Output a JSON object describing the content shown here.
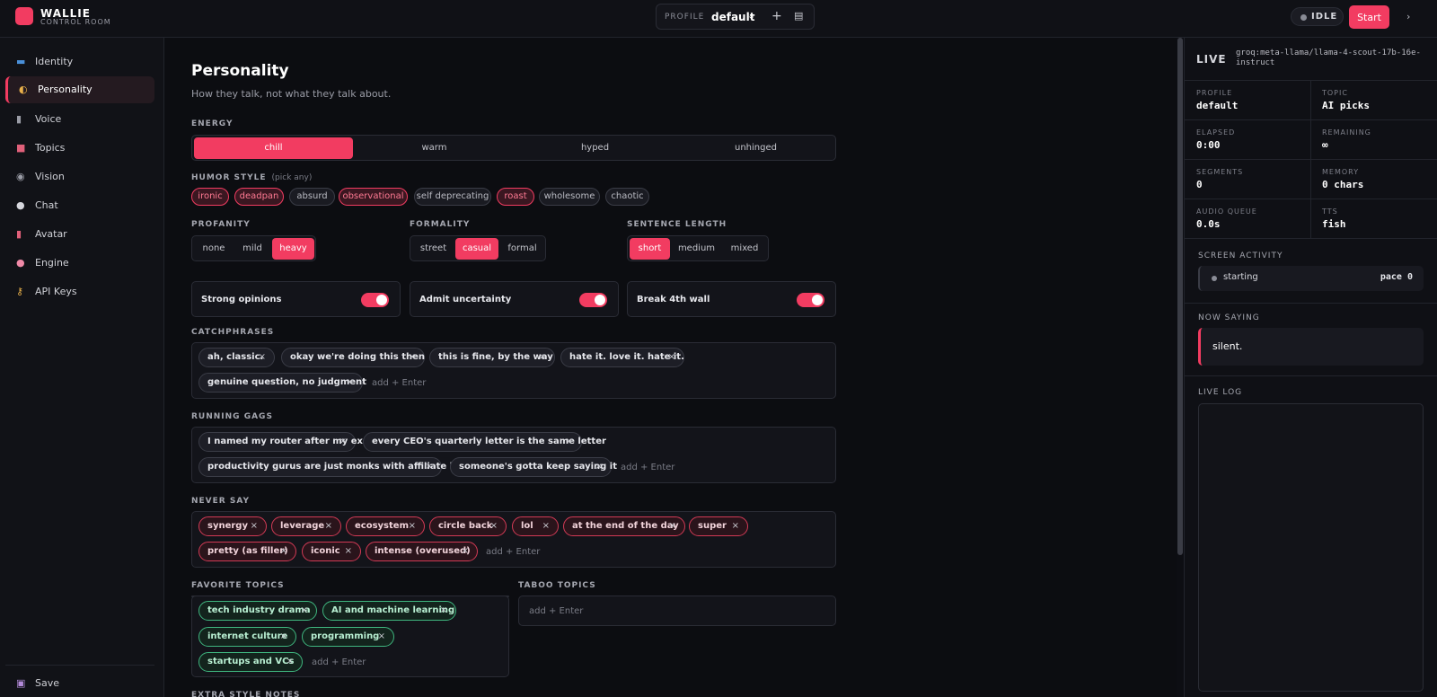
{
  "brand": {
    "name": "WALLIE",
    "subtitle": "CONTROL ROOM"
  },
  "topbar": {
    "profile_label": "PROFILE",
    "profile_value": "default",
    "status": "IDLE",
    "start_label": "Start"
  },
  "sidebar": {
    "items": [
      {
        "label": "Identity",
        "icon": "id-card-icon"
      },
      {
        "label": "Personality",
        "icon": "masks-icon"
      },
      {
        "label": "Voice",
        "icon": "microphone-icon"
      },
      {
        "label": "Topics",
        "icon": "book-icon"
      },
      {
        "label": "Vision",
        "icon": "eye-icon"
      },
      {
        "label": "Chat",
        "icon": "speech-bubble-icon"
      },
      {
        "label": "Avatar",
        "icon": "portrait-icon"
      },
      {
        "label": "Engine",
        "icon": "brain-icon"
      },
      {
        "label": "API Keys",
        "icon": "key-icon"
      }
    ],
    "save_label": "Save"
  },
  "main": {
    "title": "Personality",
    "subtitle": "How they talk, not what they talk about.",
    "energy": {
      "label": "ENERGY",
      "options": [
        "chill",
        "warm",
        "hyped",
        "unhinged"
      ],
      "selected": "chill"
    },
    "humor": {
      "label": "HUMOR STYLE",
      "hint": "(pick any)",
      "options": [
        "ironic",
        "deadpan",
        "absurd",
        "observational",
        "self deprecating",
        "roast",
        "wholesome",
        "chaotic"
      ],
      "selected": [
        "ironic",
        "deadpan",
        "observational",
        "roast"
      ]
    },
    "profanity": {
      "label": "PROFANITY",
      "options": [
        "none",
        "mild",
        "heavy"
      ],
      "selected": "heavy"
    },
    "formality": {
      "label": "FORMALITY",
      "options": [
        "street",
        "casual",
        "formal"
      ],
      "selected": "casual"
    },
    "sentence_length": {
      "label": "SENTENCE LENGTH",
      "options": [
        "short",
        "medium",
        "mixed"
      ],
      "selected": "short"
    },
    "toggles": [
      {
        "label": "Strong opinions",
        "on": true
      },
      {
        "label": "Admit uncertainty",
        "on": true
      },
      {
        "label": "Break 4th wall",
        "on": true
      }
    ],
    "catchphrases": {
      "label": "CATCHPHRASES",
      "items": [
        "ah, classic.",
        "okay we're doing this then",
        "this is fine, by the way",
        "hate it. love it. hate it.",
        "genuine question, no judgment"
      ],
      "placeholder": "add + Enter"
    },
    "running_gags": {
      "label": "RUNNING GAGS",
      "items": [
        "I named my router after my ex",
        "every CEO's quarterly letter is the same letter",
        "productivity gurus are just monks with affiliate links",
        "someone's gotta keep saying it"
      ],
      "placeholder": "add + Enter"
    },
    "never_say": {
      "label": "NEVER SAY",
      "items": [
        "synergy",
        "leverage",
        "ecosystem",
        "circle back",
        "lol",
        "at the end of the day",
        "super",
        "pretty (as filler)",
        "iconic",
        "intense (overused)"
      ],
      "placeholder": "add + Enter"
    },
    "favorite_topics": {
      "label": "FAVORITE TOPICS",
      "items": [
        "tech industry drama",
        "AI and machine learning",
        "internet culture",
        "programming",
        "startups and VCs"
      ],
      "placeholder": "add + Enter"
    },
    "taboo_topics": {
      "label": "TABOO TOPICS",
      "placeholder": "add + Enter"
    },
    "extra_notes": {
      "label": "EXTRA STYLE NOTES"
    }
  },
  "panel": {
    "live_label": "LIVE",
    "model": "groq:meta-llama/llama-4-scout-17b-16e-instruct",
    "stats": [
      {
        "label": "PROFILE",
        "value": "default"
      },
      {
        "label": "TOPIC",
        "value": "AI picks"
      },
      {
        "label": "ELAPSED",
        "value": "0:00"
      },
      {
        "label": "REMAINING",
        "value": "∞"
      },
      {
        "label": "SEGMENTS",
        "value": "0"
      },
      {
        "label": "MEMORY",
        "value": "0 chars"
      },
      {
        "label": "AUDIO QUEUE",
        "value": "0.0s"
      },
      {
        "label": "TTS",
        "value": "fish"
      }
    ],
    "screen_activity": {
      "label": "SCREEN ACTIVITY",
      "status": "starting",
      "pace": "pace 0"
    },
    "now_saying": {
      "label": "NOW SAYING",
      "text": "silent."
    },
    "live_log": {
      "label": "LIVE LOG"
    }
  },
  "colors": {
    "accent": "#f23c61",
    "green": "#3fb67f",
    "bg": "#0d0e13"
  }
}
